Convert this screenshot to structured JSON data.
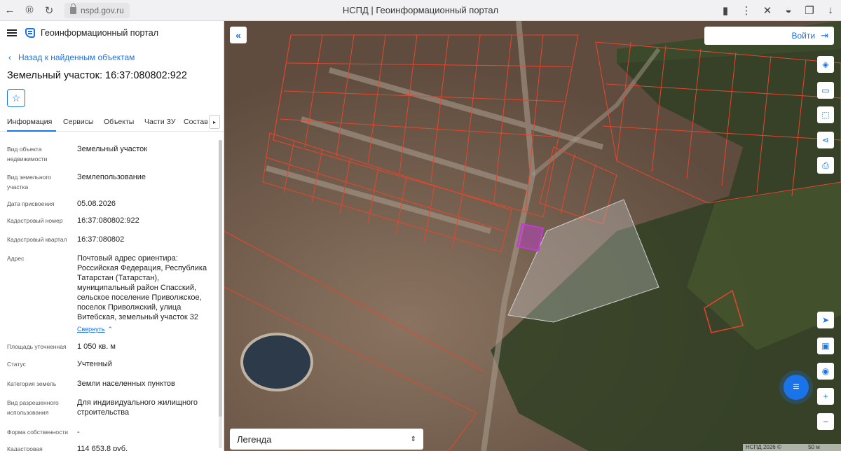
{
  "browser": {
    "url": "nspd.gov.ru",
    "tab_title": "НСПД | Геоинформационный портал"
  },
  "app": {
    "title": "Геоинформационный портал",
    "back_label": "Назад к найденным объектам",
    "parcel_title": "Земельный участок: 16:37:080802:922"
  },
  "tabs": [
    "Информация",
    "Сервисы",
    "Объекты",
    "Части ЗУ",
    "Состав"
  ],
  "fields": [
    {
      "label": "Вид объекта недвижимости",
      "value": "Земельный участок"
    },
    {
      "label": "Вид земельного участка",
      "value": "Землепользование"
    },
    {
      "label": "Дата присвоения",
      "value": "05.08.2026"
    },
    {
      "label": "Кадастровый номер",
      "value": "16:37:080802:922"
    },
    {
      "label": "Кадастровый квартал",
      "value": "16:37:080802"
    },
    {
      "label": "Адрес",
      "value": "Почтовый адрес ориентира: Российская Федерация, Республика Татарстан (Татарстан), муниципальный район Спасский, сельское поселение Приволжское, поселок Приволжский, улица Витебская, земельный участок 32"
    },
    {
      "label": "Площадь уточненная",
      "value": "1 050 кв. м"
    },
    {
      "label": "Статус",
      "value": "Учтенный"
    },
    {
      "label": "Категория земель",
      "value": "Земли населенных пунктов"
    },
    {
      "label": "Вид разрешенного использования",
      "value": "Для индивидуального жилищного строительства"
    },
    {
      "label": "Форма собственности",
      "value": "-"
    },
    {
      "label": "Кадастровая",
      "value": "114 653,8 руб."
    }
  ],
  "collapse_label": "Свернуть",
  "map": {
    "login_label": "Войти",
    "legend_label": "Легенда",
    "scale_attribution": "НСПД 2026 ©",
    "scale_label": "50 м"
  },
  "colors": {
    "accent": "#1a73e8",
    "parcel_outline": "#e8452c",
    "selected_parcel": "#c43bd4"
  }
}
